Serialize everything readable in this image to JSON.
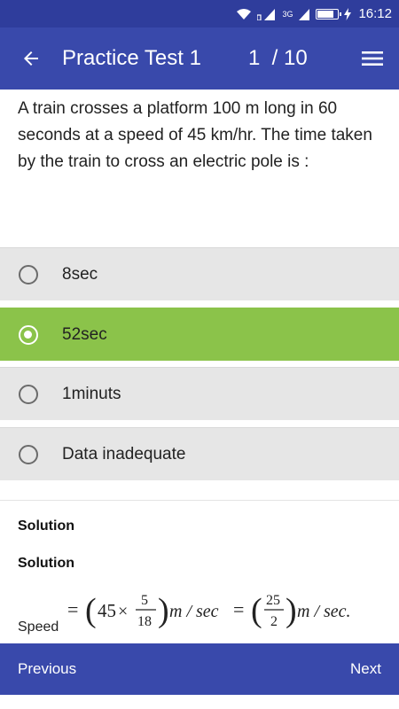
{
  "status_bar": {
    "time": "16:12",
    "battery_level": 0.9,
    "icons": [
      "wifi-icon",
      "signal-icon",
      "3g-signal-icon",
      "battery-icon",
      "charging-icon"
    ],
    "network_label": "3G"
  },
  "app_bar": {
    "title": "Practice Test 1",
    "counter": "1  / 10",
    "back_icon": "arrow-left-icon",
    "menu_icon": "hamburger-menu-icon"
  },
  "question": {
    "text": "A train crosses a platform 100 m long in 60 seconds at a speed of 45 km/hr. The time taken by the train to cross an electric pole is :"
  },
  "options": [
    {
      "label": "8sec",
      "selected": false
    },
    {
      "label": "52sec",
      "selected": true
    },
    {
      "label": "1minuts",
      "selected": false
    },
    {
      "label": "Data inadequate",
      "selected": false
    }
  ],
  "solution": {
    "heading1": "Solution",
    "heading2": "Solution",
    "formula_label": "Speed",
    "formula": {
      "eq": "=",
      "num1": "45",
      "times": "×",
      "frac1_num": "5",
      "frac1_den": "18",
      "unit": "m / sec",
      "frac2_num": "25",
      "frac2_den": "2",
      "unit_end": "m / sec."
    }
  },
  "bottom_bar": {
    "previous": "Previous",
    "next": "Next"
  },
  "colors": {
    "status_bar": "#2f3d9c",
    "app_bar": "#3949ab",
    "selected_option": "#8bc34a",
    "option_bg": "#e6e6e6"
  }
}
